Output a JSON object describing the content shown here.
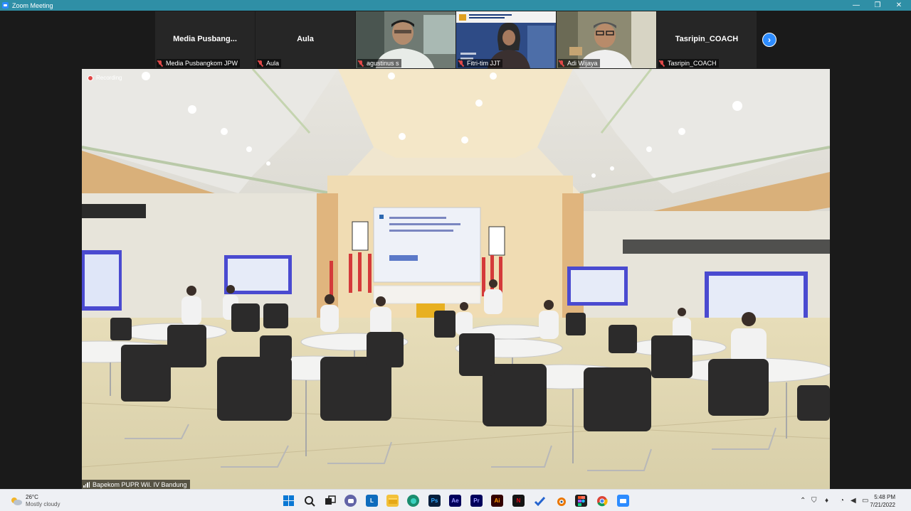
{
  "window": {
    "title": "Zoom Meeting",
    "minimize": "—",
    "maximize": "❐",
    "close": "✕"
  },
  "gallery": {
    "tiles": [
      {
        "name": "Media  Pusbang...",
        "label": "Media Pusbangkom JPW"
      },
      {
        "name": "Aula",
        "label": "Aula"
      },
      {
        "name": "",
        "label": "agustinus s"
      },
      {
        "name": "",
        "label": "Fitri-tim JJT"
      },
      {
        "name": "",
        "label": "Adi Wijaya"
      },
      {
        "name": "Tasripin_COACH",
        "label": "Tasripin_COACH"
      }
    ],
    "next_icon": "chevron-right-icon"
  },
  "main": {
    "recording_label": "Recording",
    "speaker_label": "Bapekom PUPR Wil. IV Bandung"
  },
  "taskbar": {
    "weather": {
      "temp": "26°C",
      "condition": "Mostly cloudy"
    },
    "clock": {
      "time": "5:48 PM",
      "date": "7/21/2022"
    },
    "apps": [
      {
        "name": "start",
        "label": ""
      },
      {
        "name": "search",
        "label": ""
      },
      {
        "name": "task-view",
        "label": ""
      },
      {
        "name": "chat",
        "label": ""
      },
      {
        "name": "learn",
        "label": "L"
      },
      {
        "name": "file-explorer",
        "label": ""
      },
      {
        "name": "edge",
        "label": ""
      },
      {
        "name": "photoshop",
        "label": "Ps"
      },
      {
        "name": "after-effects",
        "label": "Ae"
      },
      {
        "name": "premiere",
        "label": "Pr"
      },
      {
        "name": "illustrator",
        "label": "Ai"
      },
      {
        "name": "netflix",
        "label": "N"
      },
      {
        "name": "todo",
        "label": ""
      },
      {
        "name": "blender",
        "label": ""
      },
      {
        "name": "figma",
        "label": ""
      },
      {
        "name": "chrome",
        "label": ""
      },
      {
        "name": "zoom",
        "label": ""
      }
    ]
  }
}
